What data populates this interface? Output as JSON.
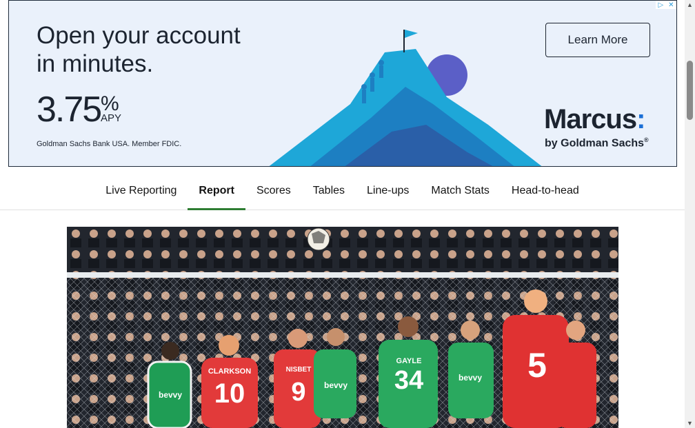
{
  "ad": {
    "headline_line1": "Open your account",
    "headline_line2": "in minutes.",
    "rate": "3.75",
    "rate_symbol": "%",
    "rate_unit": "APY",
    "legal": "Goldman Sachs Bank USA. Member FDIC.",
    "cta_label": "Learn More",
    "brand": "Marcus",
    "brand_colon": ":",
    "brand_sub": "by Goldman Sachs",
    "brand_trademark": "®",
    "colors": {
      "background": "#eaf1fb",
      "text": "#1c2430",
      "accent": "#1b6fd6"
    }
  },
  "tabs": [
    {
      "label": "Live Reporting",
      "active": false
    },
    {
      "label": "Report",
      "active": true
    },
    {
      "label": "Scores",
      "active": false
    },
    {
      "label": "Tables",
      "active": false
    },
    {
      "label": "Line-ups",
      "active": false
    },
    {
      "label": "Match Stats",
      "active": false
    },
    {
      "label": "Head-to-head",
      "active": false
    }
  ],
  "colors": {
    "active_tab_underline": "#2e7d32"
  },
  "photo": {
    "players": [
      {
        "shirt_name": "CLARKSON",
        "number": "10",
        "kit": "red"
      },
      {
        "shirt_name": "NISBET",
        "number": "9",
        "kit": "red"
      },
      {
        "shirt_name": "GAYLE",
        "number": "34",
        "kit": "green"
      },
      {
        "shirt_name": "",
        "number": "5",
        "kit": "red"
      }
    ],
    "sponsor": "bevvy"
  }
}
